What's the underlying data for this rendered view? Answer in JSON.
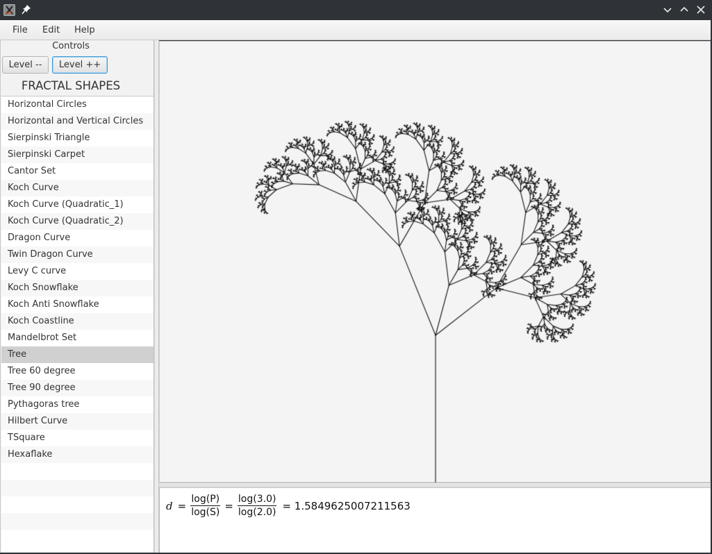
{
  "window": {
    "title_icons": [
      "app-icon",
      "pin-icon"
    ],
    "controls": [
      "minimize-icon",
      "maximize-icon",
      "close-icon"
    ]
  },
  "menu": {
    "items": [
      "File",
      "Edit",
      "Help"
    ]
  },
  "controls": {
    "label": "Controls",
    "level_down": "Level --",
    "level_up": "Level ++"
  },
  "shapes": {
    "title": "FRACTAL SHAPES",
    "items": [
      "Horizontal Circles",
      "Horizontal and Vertical Circles",
      "Sierpinski Triangle",
      "Sierpinski Carpet",
      "Cantor Set",
      "Koch Curve",
      "Koch Curve (Quadratic_1)",
      "Koch Curve (Quadratic_2)",
      "Dragon Curve",
      "Twin Dragon Curve",
      "Levy C curve",
      "Koch Snowflake",
      "Koch Anti Snowflake",
      "Koch Coastline",
      "Mandelbrot Set",
      "Tree",
      "Tree 60 degree",
      "Tree 90 degree",
      "Pythagoras tree",
      "Hilbert Curve",
      "TSquare",
      "Hexaflake"
    ],
    "selected": "Tree",
    "empty_rows": 5
  },
  "fractal": {
    "name": "Tree",
    "branches": [
      {
        "scale": 0.65,
        "angle_deg": -22
      },
      {
        "scale": 0.35,
        "angle_deg": 15
      },
      {
        "scale": 0.52,
        "angle_deg": 52
      }
    ],
    "trunk_color": "#777777",
    "branch_color": "#111111"
  },
  "formula": {
    "variable": "d",
    "eq": "=",
    "num1": "log(P)",
    "den1": "log(S)",
    "num2": "log(3.0)",
    "den2": "log(2.0)",
    "result": "= 1.5849625007211563"
  }
}
